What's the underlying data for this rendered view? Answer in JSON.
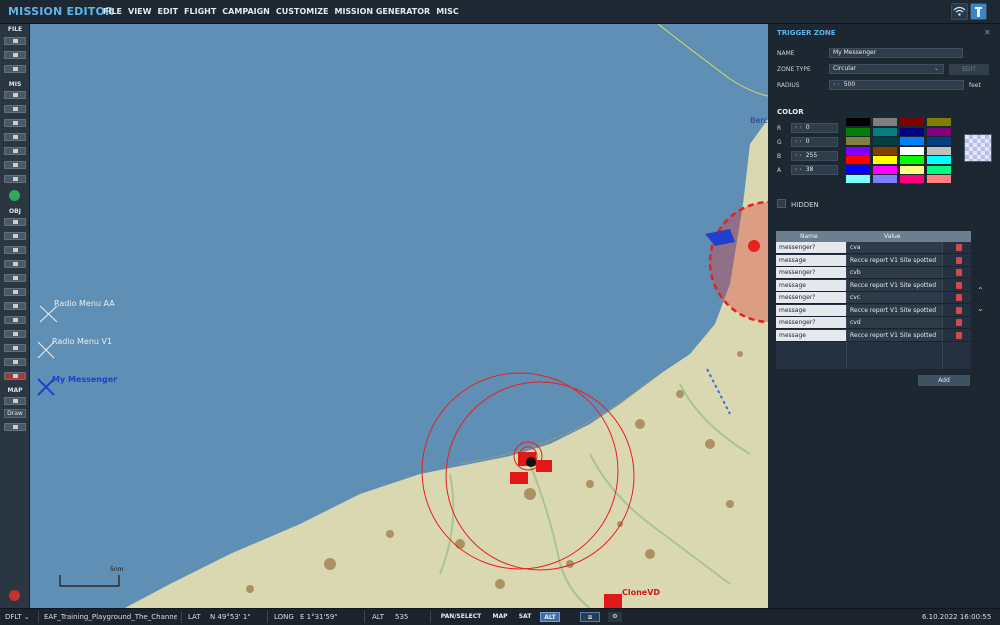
{
  "app": {
    "title": "MISSION EDITOR"
  },
  "menu": [
    "FILE",
    "VIEW",
    "EDIT",
    "FLIGHT",
    "CAMPAIGN",
    "CUSTOMIZE",
    "MISSION GENERATOR",
    "MISC"
  ],
  "toolbar": {
    "file_header": "FILE",
    "mis_header": "MIS",
    "obj_header": "OBJ",
    "map_header": "MAP",
    "draw_label": "Draw"
  },
  "map": {
    "labels": [
      {
        "text": "Radio Menu AA"
      },
      {
        "text": "Radio Menu V1"
      },
      {
        "text": "My Messenger"
      },
      {
        "text": "Berck"
      },
      {
        "text": "CloneVD"
      }
    ],
    "scale_label": "5nm",
    "colors": {
      "sea": "#5f8fb4",
      "land": "#d9d8b0",
      "zone": "#e82020",
      "blue": "#1f3fcc"
    }
  },
  "panel": {
    "title": "TRIGGER ZONE",
    "name_label": "NAME",
    "name_value": "My Messenger",
    "zone_type_label": "ZONE TYPE",
    "zone_type_value": "Circular",
    "edit_label": "EDIT",
    "radius_label": "RADIUS",
    "radius_value": "500",
    "radius_unit": "feet",
    "color_header": "COLOR",
    "channels": [
      {
        "label": "R",
        "value": "0"
      },
      {
        "label": "G",
        "value": "0"
      },
      {
        "label": "B",
        "value": "255"
      },
      {
        "label": "A",
        "value": "38"
      }
    ],
    "palette": [
      "#000000",
      "#808080",
      "#800000",
      "#808000",
      "#008000",
      "#008080",
      "#000080",
      "#800080",
      "#808040",
      "#004040",
      "#0080ff",
      "#004080",
      "#8000ff",
      "#804000",
      "#ffffff",
      "#c0c0c0",
      "#ff0000",
      "#ffff00",
      "#00ff00",
      "#00ffff",
      "#0000ff",
      "#ff00ff",
      "#ffff80",
      "#00ff80",
      "#80ffff",
      "#8080ff",
      "#ff0080",
      "#ff8080"
    ],
    "hidden_label": "HIDDEN",
    "table": {
      "headers": [
        "Name",
        "Value"
      ],
      "rows": [
        {
          "name": "messenger?",
          "value": "cva"
        },
        {
          "name": "message",
          "value": "Recce report V1 Site spotted"
        },
        {
          "name": "messenger?",
          "value": "cvb"
        },
        {
          "name": "message",
          "value": "Recce report V1 Site spotted"
        },
        {
          "name": "messenger?",
          "value": "cvc"
        },
        {
          "name": "message",
          "value": "Recce report V1 Site spotted"
        },
        {
          "name": "messenger?",
          "value": "cvd"
        },
        {
          "name": "message",
          "value": "Recce report V1 Site spotted"
        }
      ]
    },
    "add_label": "Add"
  },
  "status": {
    "profile": "DFLT",
    "mission": "EAF_Training_Playground_The_Channel",
    "lat_label": "LAT",
    "lat_value": "N 49°53' 1\"",
    "long_label": "LONG",
    "long_value": "E 1°31'59\"",
    "alt_label": "ALT",
    "alt_value": "535",
    "pan_label": "PAN/SELECT",
    "map_label": "MAP",
    "sat_label": "SAT",
    "alt_btn": "ALT",
    "datetime": "6.10.2022 16:00:55"
  }
}
